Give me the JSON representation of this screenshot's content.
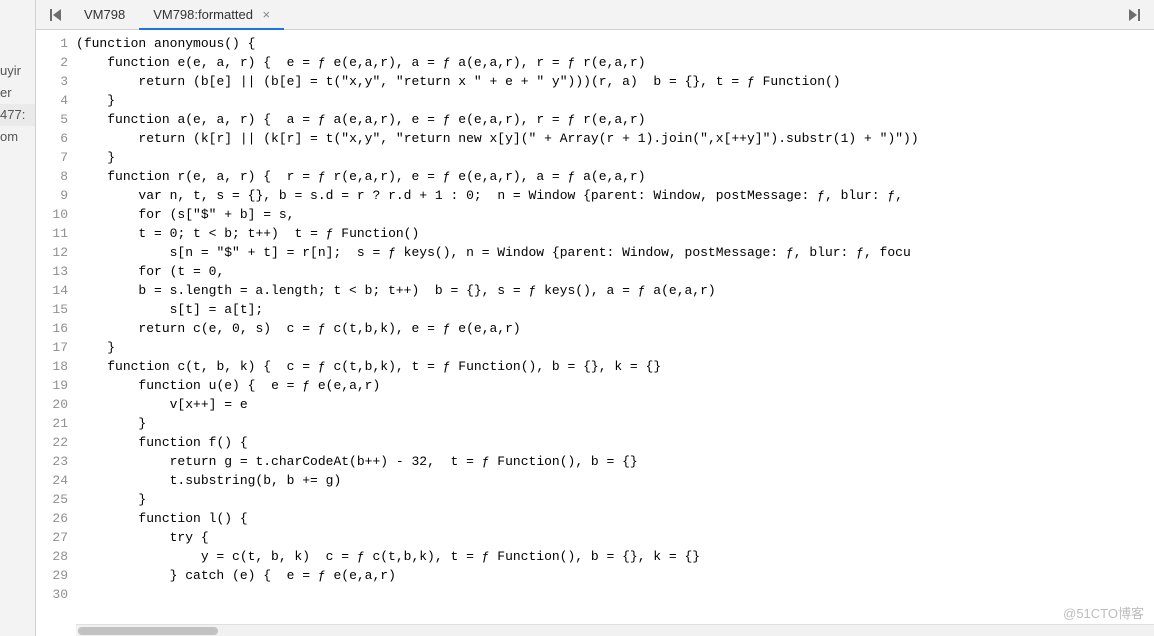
{
  "sidebar": {
    "items": [
      "uyir",
      "er",
      "477:",
      "om"
    ]
  },
  "tabs": {
    "nav_prev_icon": "◀",
    "nav_marker_icon": "⎵",
    "tab1": "VM798",
    "tab2": "VM798:formatted",
    "close": "×",
    "nav_next_icon": "▶"
  },
  "code": {
    "lines": [
      {
        "n": 1,
        "raw": "(<kw>function</kw> anonymous() {"
      },
      {
        "n": 2,
        "raw": "    <kw>function</kw> e(e, a, r) {  <hint>e = ƒ e(e,a,r), a = ƒ a(e,a,r), r = ƒ r(e,a,r)</hint>"
      },
      {
        "n": 3,
        "raw": "        <kw>return</kw> (b[e] || (b[e] = t(<str>\"x,y\"</str>, <str>\"return x \"</str> + e + <str>\" y\"</str>)))(r, a)  <hint>b = {}, t = ƒ Function()</hint>"
      },
      {
        "n": 4,
        "raw": "    }"
      },
      {
        "n": 5,
        "raw": "    <kw>function</kw> a(e, a, r) {  <hint>a = ƒ a(e,a,r), e = ƒ e(e,a,r), r = ƒ r(e,a,r)</hint>"
      },
      {
        "n": 6,
        "raw": "        <kw>return</kw> (k[r] || (k[r] = t(<str>\"x,y\"</str>, <str>\"return new x[y](\"</str> + Array(r + <num>1</num>).join(<str>\",x[++y]\"</str>).substr(<num>1</num>) + <str>\")\"</str>))"
      },
      {
        "n": 7,
        "raw": "    }"
      },
      {
        "n": 8,
        "raw": "    <kw>function</kw> r(e, a, r) {  <hint>r = ƒ r(e,a,r), e = ƒ e(e,a,r), a = ƒ a(e,a,r)</hint>"
      },
      {
        "n": 9,
        "raw": "        <kw>var</kw> n, t, s = {}, b = s.d = r ? r.d + <num>1</num> : <num>0</num>;  <hint>n = Window {parent: Window, postMessage: ƒ, blur: ƒ,</hint>"
      },
      {
        "n": 10,
        "raw": "        <kw>for</kw> (s[<str>\"$\"</str> + b] = s,"
      },
      {
        "n": 11,
        "raw": "        t = <num>0</num>; t &lt; b; t++)  <hint>t = ƒ Function()</hint>"
      },
      {
        "n": 12,
        "raw": "            s[n = <str>\"$\"</str> + t] = r[n];  <hint>s = ƒ keys(), n = Window {parent: Window, postMessage: ƒ, blur: ƒ, focu</hint>"
      },
      {
        "n": 13,
        "raw": "        <kw>for</kw> (t = <num>0</num>,"
      },
      {
        "n": 14,
        "raw": "        b = s.length = a.length; t &lt; b; t++)  <hint>b = {}, s = ƒ keys(), a = ƒ a(e,a,r)</hint>"
      },
      {
        "n": 15,
        "raw": "            s[t] = a[t];"
      },
      {
        "n": 16,
        "raw": "        <kw>return</kw> c(e, <num>0</num>, s)  <hint>c = ƒ c(t,b,k), e = ƒ e(e,a,r)</hint>"
      },
      {
        "n": 17,
        "raw": "    }"
      },
      {
        "n": 18,
        "raw": "    <kw>function</kw> c(t, b, k) {  <hint>c = ƒ c(t,b,k), t = ƒ Function(), b = {}, k = {}</hint>"
      },
      {
        "n": 19,
        "raw": "        <kw>function</kw> u(e) {  <hint>e = ƒ e(e,a,r)</hint>"
      },
      {
        "n": 20,
        "raw": "            v[x++] = e"
      },
      {
        "n": 21,
        "raw": "        }"
      },
      {
        "n": 22,
        "raw": "        <kw>function</kw> f() {"
      },
      {
        "n": 23,
        "raw": "            <kw>return</kw> g = t.charCodeAt(b++) - <num>32</num>,  <hint>t = ƒ Function(), b = {}</hint>"
      },
      {
        "n": 24,
        "raw": "            t.substring(b, b += g)"
      },
      {
        "n": 25,
        "raw": "        }"
      },
      {
        "n": 26,
        "raw": "        <kw>function</kw> l() {"
      },
      {
        "n": 27,
        "raw": "            <kw>try</kw> {"
      },
      {
        "n": 28,
        "raw": "                y = c(t, b, k)  <hint>c = ƒ c(t,b,k), t = ƒ Function(), b = {}, k = {}</hint>"
      },
      {
        "n": 29,
        "raw": "            } <kw>catch</kw> (e) {  <hint>e = ƒ e(e,a,r)</hint>"
      },
      {
        "n": 30,
        "raw": ""
      }
    ]
  },
  "watermark": "@51CTO博客"
}
